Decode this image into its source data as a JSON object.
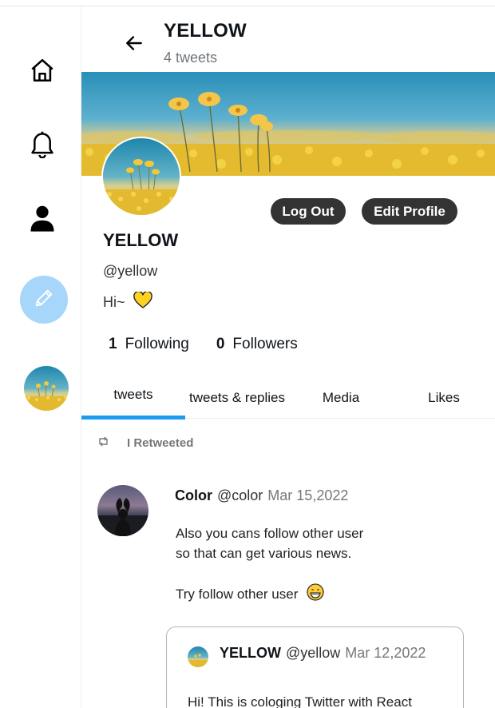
{
  "header": {
    "title": "YELLOW",
    "tweet_count": "4 tweets"
  },
  "sidebar": {
    "items": [
      "home-icon",
      "bell-icon",
      "user-icon",
      "compose-pencil-icon",
      "avatar"
    ]
  },
  "profile": {
    "name": "YELLOW",
    "handle": "@yellow",
    "bio": "Hi~",
    "bio_emoji": "yellow-heart",
    "logout_label": "Log Out",
    "edit_label": "Edit Profile",
    "following_count": "1",
    "following_label": "Following",
    "followers_count": "0",
    "followers_label": "Followers"
  },
  "tabs": [
    {
      "label": "tweets",
      "active": true
    },
    {
      "label": "tweets & replies",
      "active": false
    },
    {
      "label": "Media",
      "active": false
    },
    {
      "label": "Likes",
      "active": false
    }
  ],
  "tweet": {
    "retweet_label": "I Retweeted",
    "author_name": "Color",
    "author_handle": "@color",
    "date": "Mar 15,2022",
    "line1": "Also you cans follow other user",
    "line2": "so that can get various news.",
    "line3": "Try follow other user",
    "emoji": "grinning-face",
    "quote": {
      "author_name": "YELLOW",
      "author_handle": "@yellow",
      "date": "Mar 12,2022",
      "text": "Hi! This is cologing Twitter with React"
    }
  },
  "colors": {
    "accent": "#1d9bf0",
    "compose_bg": "#a7d6fb",
    "pill_bg": "#333333"
  }
}
